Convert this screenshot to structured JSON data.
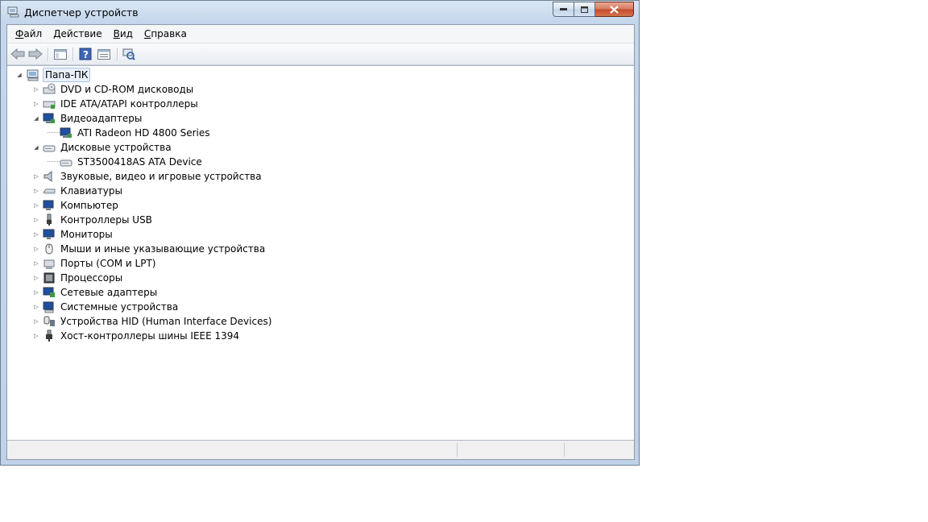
{
  "window": {
    "title": "Диспетчер устройств"
  },
  "menu": [
    {
      "key": "Ф",
      "rest": "айл"
    },
    {
      "key": "Д",
      "rest": "ействие"
    },
    {
      "key": "В",
      "rest": "ид"
    },
    {
      "key": "С",
      "rest": "правка"
    }
  ],
  "toolbar": {
    "buttons": [
      "back-arrow-icon",
      "forward-arrow-icon",
      "show-hide-tree-icon",
      "help-icon",
      "properties-icon",
      "scan-hardware-icon"
    ]
  },
  "tree": {
    "root": "Папа-ПК",
    "items": [
      {
        "label": "DVD и CD-ROM дисководы",
        "expanded": false
      },
      {
        "label": "IDE ATA/ATAPI контроллеры",
        "expanded": false
      },
      {
        "label": "Видеоадаптеры",
        "expanded": true
      },
      {
        "label": "ATI Radeon HD 4800 Series",
        "child": true
      },
      {
        "label": "Дисковые устройства",
        "expanded": true
      },
      {
        "label": "ST3500418AS ATA Device",
        "child": true
      },
      {
        "label": "Звуковые, видео и игровые устройства",
        "expanded": false
      },
      {
        "label": "Клавиатуры",
        "expanded": false
      },
      {
        "label": "Компьютер",
        "expanded": false
      },
      {
        "label": "Контроллеры USB",
        "expanded": false
      },
      {
        "label": "Мониторы",
        "expanded": false
      },
      {
        "label": "Мыши и иные указывающие устройства",
        "expanded": false
      },
      {
        "label": "Порты (COM и LPT)",
        "expanded": false
      },
      {
        "label": "Процессоры",
        "expanded": false
      },
      {
        "label": "Сетевые адаптеры",
        "expanded": false
      },
      {
        "label": "Системные устройства",
        "expanded": false
      },
      {
        "label": "Устройства HID (Human Interface Devices)",
        "expanded": false
      },
      {
        "label": "Хост-контроллеры шины IEEE 1394",
        "expanded": false
      }
    ]
  }
}
